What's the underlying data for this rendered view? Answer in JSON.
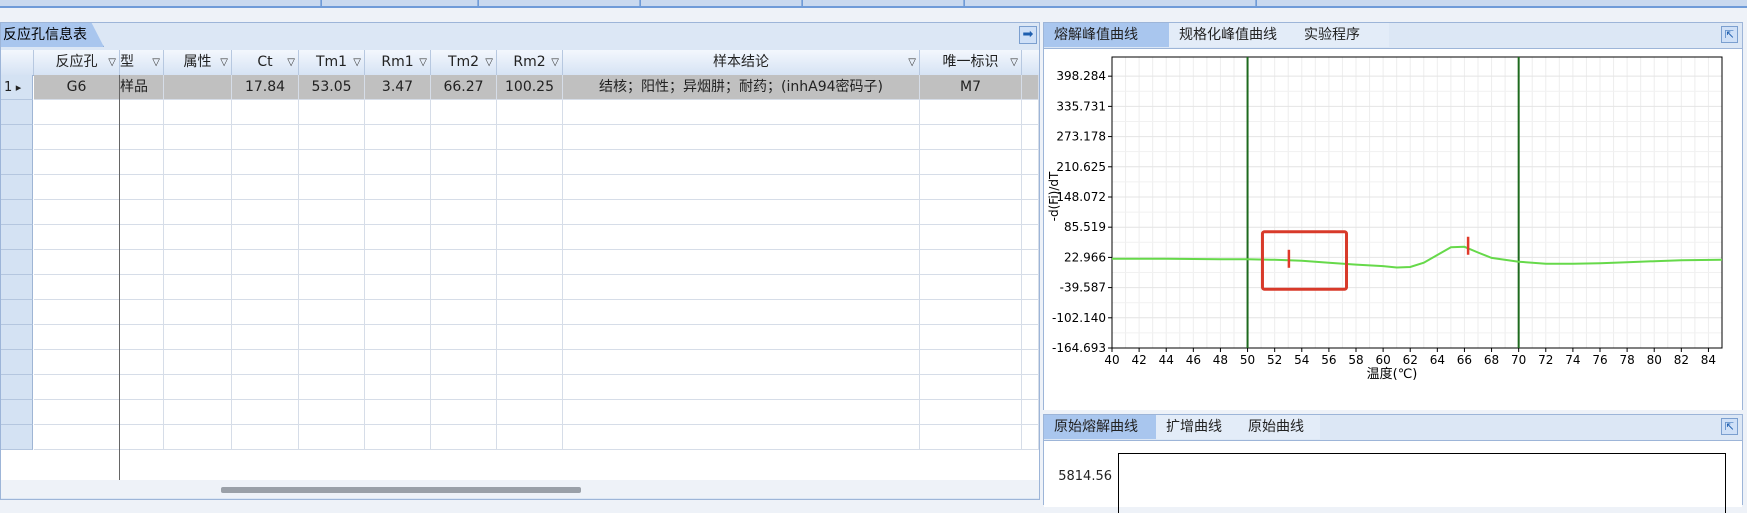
{
  "left_panel": {
    "tab_label": "反应孔信息表",
    "columns": [
      {
        "label": "反应孔"
      },
      {
        "label": "型"
      },
      {
        "label": "属性"
      },
      {
        "label": "Ct"
      },
      {
        "label": "Tm1"
      },
      {
        "label": "Rm1"
      },
      {
        "label": "Tm2"
      },
      {
        "label": "Rm2"
      },
      {
        "label": "样本结论"
      },
      {
        "label": "唯一标识"
      }
    ],
    "rows": [
      {
        "index": "1",
        "cells": [
          "G6",
          "样品",
          "",
          "17.84",
          "53.05",
          "3.47",
          "66.27",
          "100.25",
          "结核；阳性；异烟肼；耐药；(inhA94密码子)",
          "M7"
        ]
      }
    ],
    "empty_row_count": 14
  },
  "right_top": {
    "tabs": [
      "熔解峰值曲线",
      "规格化峰值曲线",
      "实验程序"
    ],
    "active_tab": 0
  },
  "right_bottom": {
    "tabs": [
      "原始熔解曲线",
      "扩增曲线",
      "原始曲线"
    ],
    "active_tab": 0,
    "visible_y_tick": "5814.56"
  },
  "chart_data": {
    "type": "line",
    "title": "",
    "xlabel": "温度(℃)",
    "ylabel": "-d(Fi)/dT",
    "xlim": [
      40,
      85
    ],
    "ylim": [
      -164.693,
      438
    ],
    "x_ticks": [
      40,
      42,
      44,
      46,
      48,
      50,
      52,
      54,
      56,
      58,
      60,
      62,
      64,
      66,
      68,
      70,
      72,
      74,
      76,
      78,
      80,
      82,
      84
    ],
    "y_ticks": [
      "398.284",
      "335.731",
      "273.178",
      "210.625",
      "148.072",
      "85.519",
      "22.966",
      "-39.587",
      "-102.140",
      "-164.693"
    ],
    "y_tick_values": [
      398.284,
      335.731,
      273.178,
      210.625,
      148.072,
      85.519,
      22.966,
      -39.587,
      -102.14,
      -164.693
    ],
    "grid": true,
    "series": [
      {
        "color": "#66d94a",
        "x": [
          40,
          44,
          48,
          50,
          52,
          54,
          56,
          58,
          60,
          61,
          62,
          63,
          64,
          65,
          66,
          67,
          68,
          70,
          72,
          74,
          76,
          78,
          80,
          82,
          85
        ],
        "y": [
          20,
          20,
          19,
          19,
          18,
          16,
          12,
          8,
          5,
          2,
          3,
          12,
          28,
          44,
          45,
          33,
          22,
          14,
          10,
          10,
          11,
          13,
          15,
          17,
          18
        ]
      }
    ],
    "vertical_lines": [
      {
        "x": 50,
        "color": "#1e6a1e"
      },
      {
        "x": 70,
        "color": "#1e6a1e"
      }
    ],
    "peak_markers": [
      {
        "x": 53.05,
        "y": 18,
        "color": "#e03a2a"
      },
      {
        "x": 66.27,
        "y": 45,
        "color": "#e03a2a"
      }
    ],
    "highlight_box": {
      "x0": 51.1,
      "x1": 57.3,
      "y0": -43,
      "y1": 76,
      "color": "#d83a2a"
    }
  }
}
